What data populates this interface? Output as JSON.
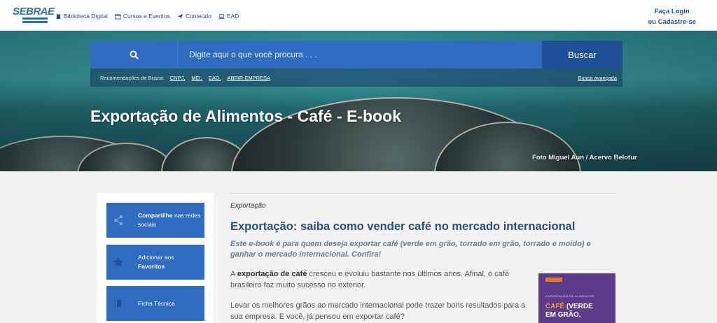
{
  "header": {
    "logo": "SEBRAE",
    "nav": [
      {
        "label": "Biblioteca Digital",
        "icon": "book-icon"
      },
      {
        "label": "Cursos e Eventos",
        "icon": "calendar-icon"
      },
      {
        "label": "Conteúdo",
        "icon": "paper-plane-icon"
      },
      {
        "label": "EAD",
        "icon": "laptop-icon"
      }
    ],
    "login_line1": "Faça Login",
    "login_line2": "ou Cadastre-se"
  },
  "search": {
    "placeholder": "Digite aqui o que você procura . . .",
    "button_label": "Buscar",
    "recs_label": "Recomendações de Busca:",
    "tags": [
      "CNPJ,",
      "MEI,",
      "EAD,",
      "ABRIR EMPRESA"
    ],
    "advanced": "Busca avançada"
  },
  "hero": {
    "title": "Exportação de Alimentos - Café - E-book",
    "credit": "Foto Miguel Aun / Acervo Belotur"
  },
  "sidebar": {
    "share_bold": "Compartilhe",
    "share_rest": " nas redes sociais",
    "fav_line1": "Adicionar aos",
    "fav_bold": "Favoritos",
    "tech": "Ficha Técnica"
  },
  "article": {
    "category": "Exportação",
    "title": "Exportação: saiba como vender café no mercado internacional",
    "subtitle": "Este e-book é para quem deseja exportar café (verde em grão, torrado em grão, torrado e moído) e ganhar o mercado internacional. Confira!",
    "p1_pre": "A ",
    "p1_bold": "exportação de café",
    "p1_post": " cresceu e evoluiu bastante nos últimos anos. Afinal, o café brasileiro faz muito sucesso no exterior.",
    "p2": "Levar os melhores grãos ao mercado internacional pode trazer bons resultados para a sua empresa. E você, já pensou em exportar café?"
  },
  "book": {
    "topic": "EXPORTAÇÃO DE ALIMENTOS",
    "line1": "CAFÉ",
    "line1b": " (VERDE",
    "line2": "EM GRÃO,"
  },
  "colors": {
    "primary": "#2f6bbf",
    "dark_blue": "#1f4f96",
    "title_blue": "#2a4f7a"
  }
}
